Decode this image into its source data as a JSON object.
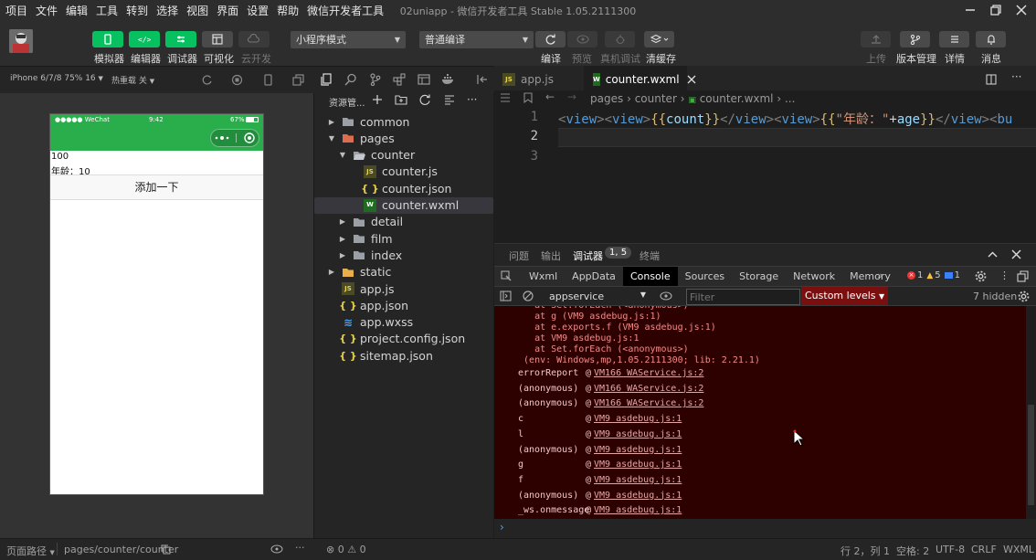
{
  "menubar": {
    "items": [
      "项目",
      "文件",
      "编辑",
      "工具",
      "转到",
      "选择",
      "视图",
      "界面",
      "设置",
      "帮助",
      "微信开发者工具"
    ],
    "title": "02uniapp - 微信开发者工具 Stable 1.05.2111300"
  },
  "toolbar": {
    "simulator": "模拟器",
    "editor": "编辑器",
    "debugger": "调试器",
    "visualize": "可视化",
    "cloud": "云开发",
    "mode": "小程序模式",
    "compile_mode": "普通编译",
    "compile": "编译",
    "preview": "预览",
    "real_debug": "真机调试",
    "clear_cache": "清缓存",
    "upload": "上传",
    "version": "版本管理",
    "details": "详情",
    "messages": "消息"
  },
  "subbar": {
    "device": "iPhone 6/7/8 75% 16",
    "hot_reload": "热重载 关"
  },
  "phone": {
    "carrier": "●●●●● WeChat",
    "time": "9:42",
    "battery": "67%",
    "count": "100",
    "age_line": "年龄：10",
    "button": "添加一下"
  },
  "explorer": {
    "title": "资源管...",
    "items": [
      {
        "label": "common",
        "type": "folder",
        "state": "collapsed",
        "depth": 1
      },
      {
        "label": "pages",
        "type": "folder-red",
        "state": "expanded",
        "depth": 1
      },
      {
        "label": "counter",
        "type": "folder-open",
        "state": "expanded",
        "depth": 2
      },
      {
        "label": "counter.js",
        "type": "js",
        "depth": 3
      },
      {
        "label": "counter.json",
        "type": "json",
        "depth": 3
      },
      {
        "label": "counter.wxml",
        "type": "wxml",
        "depth": 3,
        "selected": true
      },
      {
        "label": "detail",
        "type": "folder",
        "state": "collapsed",
        "depth": 2
      },
      {
        "label": "film",
        "type": "folder",
        "state": "collapsed",
        "depth": 2
      },
      {
        "label": "index",
        "type": "folder",
        "state": "collapsed",
        "depth": 2
      },
      {
        "label": "static",
        "type": "folder-yellow",
        "state": "collapsed",
        "depth": 1
      },
      {
        "label": "app.js",
        "type": "js",
        "depth": 1
      },
      {
        "label": "app.json",
        "type": "json",
        "depth": 1
      },
      {
        "label": "app.wxss",
        "type": "wxss",
        "depth": 1
      },
      {
        "label": "project.config.json",
        "type": "json",
        "depth": 1
      },
      {
        "label": "sitemap.json",
        "type": "json",
        "depth": 1
      }
    ]
  },
  "editor": {
    "tabs": [
      {
        "label": "app.js",
        "active": false
      },
      {
        "label": "counter.wxml",
        "active": true
      }
    ],
    "breadcrumb": [
      "pages",
      "counter",
      "counter.wxml",
      "..."
    ],
    "line_numbers": [
      "1",
      "2",
      "3"
    ],
    "code_line1": "<view><view>{{count}}</view><view>{{\"年龄：\"+age}}</view><bu"
  },
  "devtools": {
    "tabs": [
      "问题",
      "输出",
      "调试器",
      "终端"
    ],
    "badge": "1, 5",
    "chrome_tabs": [
      "Wxml",
      "AppData",
      "Console",
      "Sources",
      "Storage",
      "Network",
      "Memory"
    ],
    "errors": "1",
    "warnings": "5",
    "infos": "1",
    "context": "appservice",
    "filter_placeholder": "Filter",
    "levels": "Custom levels",
    "hidden": "7 hidden",
    "stack_lines": [
      "    at Set.forEach (<anonymous>)",
      "    at g (VM9 asdebug.js:1)",
      "    at e.exports.f (VM9 asdebug.js:1)",
      "    at VM9 asdebug.js:1",
      "    at Set.forEach (<anonymous>)",
      "  (env: Windows,mp,1.05.2111300; lib: 2.21.1)"
    ],
    "frames": [
      {
        "fn": "errorReport",
        "loc": "VM166 WAService.js:2"
      },
      {
        "fn": "(anonymous)",
        "loc": "VM166 WAService.js:2"
      },
      {
        "fn": "(anonymous)",
        "loc": "VM166 WAService.js:2"
      },
      {
        "fn": "c",
        "loc": "VM9 asdebug.js:1"
      },
      {
        "fn": "l",
        "loc": "VM9 asdebug.js:1"
      },
      {
        "fn": "(anonymous)",
        "loc": "VM9 asdebug.js:1"
      },
      {
        "fn": "g",
        "loc": "VM9 asdebug.js:1"
      },
      {
        "fn": "f",
        "loc": "VM9 asdebug.js:1"
      },
      {
        "fn": "(anonymous)",
        "loc": "VM9 asdebug.js:1"
      },
      {
        "fn": "_ws.onmessage",
        "loc": "VM9 asdebug.js:1"
      }
    ],
    "prompt": "›"
  },
  "statusbar": {
    "page_path_label": "页面路径",
    "page_path": "pages/counter/counter",
    "problems_errors": "0",
    "problems_warnings": "0",
    "position": "行 2，列 1",
    "spaces": "空格: 2",
    "encoding": "UTF-8",
    "eol": "CRLF",
    "lang": "WXML"
  },
  "colors": {
    "accent_green": "#1aad19",
    "error_bg": "#2e0101",
    "active_tab_text": "#ffffff"
  }
}
